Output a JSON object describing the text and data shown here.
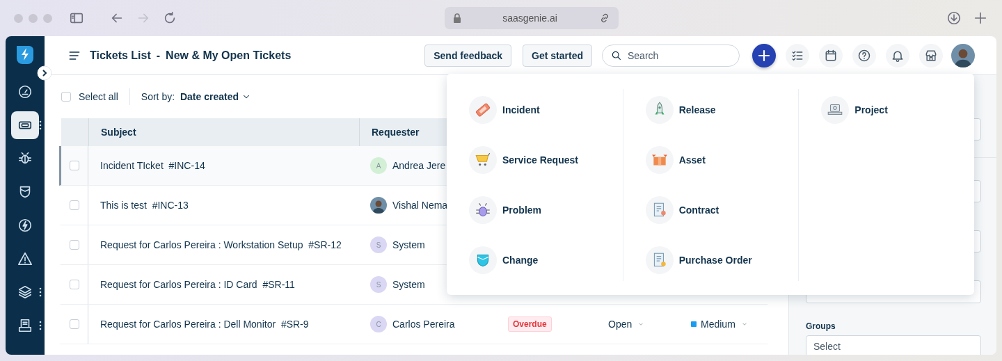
{
  "browser": {
    "url": "saasgenie.ai",
    "forward_disabled": true
  },
  "sidebar": {
    "items": [
      {
        "selected": false,
        "has_menu": false
      },
      {
        "selected": true,
        "has_menu": true
      },
      {
        "selected": false,
        "has_menu": false
      },
      {
        "selected": false,
        "has_menu": false
      },
      {
        "selected": false,
        "has_menu": false
      },
      {
        "selected": false,
        "has_menu": false
      },
      {
        "selected": false,
        "has_menu": true
      },
      {
        "selected": false,
        "has_menu": true
      }
    ]
  },
  "header": {
    "title": "Tickets List",
    "separator": "-",
    "view": "New & My Open Tickets",
    "buttons": [
      "Send feedback",
      "Get started"
    ],
    "search": {
      "placeholder": "Search"
    }
  },
  "toolbar": {
    "select_all": {
      "label": "Select all",
      "checked": false
    },
    "sort": {
      "label": "Sort by:",
      "value": "Date created"
    }
  },
  "table": {
    "columns": [
      "Subject",
      "Requester"
    ],
    "rows": [
      {
        "subject": "Incident TIcket",
        "id": "#INC-14",
        "requester": "Andrea Jere",
        "avatar": {
          "kind": "initial",
          "initial": "A",
          "color": "#d3f0d6"
        },
        "checked": false,
        "selected": true
      },
      {
        "subject": "This is test",
        "id": "#INC-13",
        "requester": "Vishal Nema",
        "avatar": {
          "kind": "photo"
        },
        "checked": false,
        "selected": false
      },
      {
        "subject": "Request for Carlos Pereira : Workstation Setup",
        "id": "#SR-12",
        "requester": "System",
        "avatar": {
          "kind": "initial",
          "initial": "S",
          "color": "#d9d7f3"
        },
        "checked": false,
        "selected": false
      },
      {
        "subject": "Request for Carlos Pereira : ID Card",
        "id": "#SR-11",
        "requester": "System",
        "avatar": {
          "kind": "initial",
          "initial": "S",
          "color": "#d9d7f3"
        },
        "checked": false,
        "selected": false
      },
      {
        "subject": "Request for Carlos Pereira : Dell Monitor",
        "id": "#SR-9",
        "requester": "Carlos Pereira",
        "avatar": {
          "kind": "initial",
          "initial": "C",
          "color": "#d9d7f3"
        },
        "checked": false,
        "selected": false,
        "due": "Overdue",
        "status": "Open",
        "priority": {
          "label": "Medium",
          "color": "#1a9cf0"
        }
      }
    ]
  },
  "filter_panel": {
    "fields": [
      {
        "label": "Groups",
        "placeholder": "Select"
      }
    ]
  },
  "create_menu": {
    "columns": [
      [
        {
          "label": "Incident"
        },
        {
          "label": "Service Request"
        },
        {
          "label": "Problem"
        },
        {
          "label": "Change"
        }
      ],
      [
        {
          "label": "Release"
        },
        {
          "label": "Asset"
        },
        {
          "label": "Contract"
        },
        {
          "label": "Purchase Order"
        }
      ],
      [
        {
          "label": "Project"
        }
      ]
    ]
  }
}
